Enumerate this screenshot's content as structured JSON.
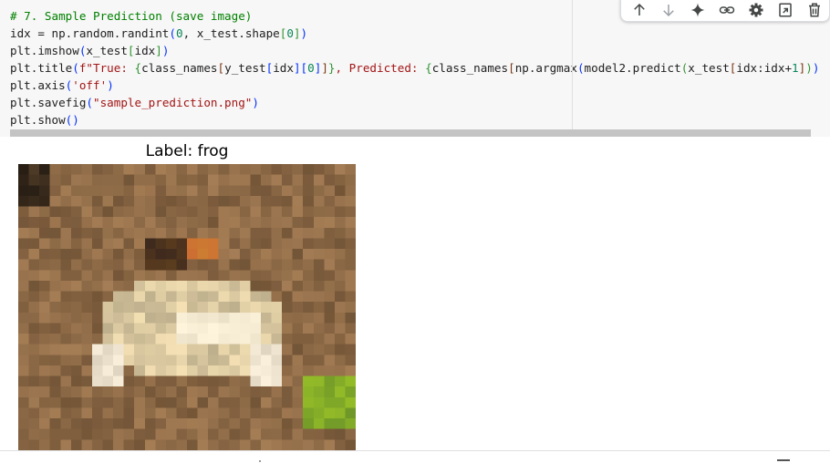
{
  "code_cell": {
    "lines": [
      [
        {
          "t": "# 7. Sample Prediction (save image)",
          "c": "tk-comment"
        }
      ],
      [
        {
          "t": "idx = np.random.randint"
        },
        {
          "t": "(",
          "c": "tk-br1"
        },
        {
          "t": "0",
          "c": "tk-num"
        },
        {
          "t": ", x_test.shape"
        },
        {
          "t": "[",
          "c": "tk-br2"
        },
        {
          "t": "0",
          "c": "tk-num"
        },
        {
          "t": "]",
          "c": "tk-br2"
        },
        {
          "t": ")",
          "c": "tk-br1"
        }
      ],
      [
        {
          "t": "plt.imshow"
        },
        {
          "t": "(",
          "c": "tk-br1"
        },
        {
          "t": "x_test"
        },
        {
          "t": "[",
          "c": "tk-br2"
        },
        {
          "t": "idx"
        },
        {
          "t": "]",
          "c": "tk-br2"
        },
        {
          "t": ")",
          "c": "tk-br1"
        }
      ],
      [
        {
          "t": "plt.title"
        },
        {
          "t": "(",
          "c": "tk-br1"
        },
        {
          "t": "f\"True: ",
          "c": "tk-string"
        },
        {
          "t": "{",
          "c": "tk-br2"
        },
        {
          "t": "class_names"
        },
        {
          "t": "[",
          "c": "tk-br3"
        },
        {
          "t": "y_test"
        },
        {
          "t": "[",
          "c": "tk-br1"
        },
        {
          "t": "idx"
        },
        {
          "t": "]",
          "c": "tk-br1"
        },
        {
          "t": "[",
          "c": "tk-br1"
        },
        {
          "t": "0",
          "c": "tk-num"
        },
        {
          "t": "]",
          "c": "tk-br1"
        },
        {
          "t": "]",
          "c": "tk-br3"
        },
        {
          "t": "}",
          "c": "tk-br2"
        },
        {
          "t": ", Predicted: ",
          "c": "tk-string"
        },
        {
          "t": "{",
          "c": "tk-br2"
        },
        {
          "t": "class_names"
        },
        {
          "t": "[",
          "c": "tk-br3"
        },
        {
          "t": "np.argmax"
        },
        {
          "t": "(",
          "c": "tk-br1"
        },
        {
          "t": "model2.predict"
        },
        {
          "t": "(",
          "c": "tk-br2"
        },
        {
          "t": "x_test"
        },
        {
          "t": "[",
          "c": "tk-br3"
        },
        {
          "t": "idx:idx+"
        },
        {
          "t": "1",
          "c": "tk-num"
        },
        {
          "t": "]",
          "c": "tk-br3"
        },
        {
          "t": ")",
          "c": "tk-br2"
        },
        {
          "t": ")",
          "c": "tk-br1"
        }
      ],
      [
        {
          "t": "plt.axis"
        },
        {
          "t": "(",
          "c": "tk-br1"
        },
        {
          "t": "'off'",
          "c": "tk-string"
        },
        {
          "t": ")",
          "c": "tk-br1"
        }
      ],
      [
        {
          "t": "plt.savefig"
        },
        {
          "t": "(",
          "c": "tk-br1"
        },
        {
          "t": "\"sample_prediction.png\"",
          "c": "tk-string"
        },
        {
          "t": ")",
          "c": "tk-br1"
        }
      ],
      [
        {
          "t": "plt.show"
        },
        {
          "t": "()",
          "c": "tk-br1"
        }
      ]
    ]
  },
  "toolbar": {
    "buttons": [
      {
        "name": "move-cell-up-button",
        "icon": "arrow-up-icon"
      },
      {
        "name": "move-cell-down-button",
        "icon": "arrow-down-icon"
      },
      {
        "name": "gemini-button",
        "icon": "sparkle-icon"
      },
      {
        "name": "link-to-cell-button",
        "icon": "link-icon"
      },
      {
        "name": "cell-settings-button",
        "icon": "gear-icon"
      },
      {
        "name": "open-in-tab-button",
        "icon": "mirror-cell-icon"
      },
      {
        "name": "delete-cell-button",
        "icon": "trash-icon"
      }
    ],
    "icon_color": "#444746"
  },
  "output": {
    "plot_title": "Label: frog",
    "image_description_icon": "frog-image"
  },
  "colors": {
    "comment": "#008000",
    "string": "#a31515",
    "number": "#098658",
    "code_bg": "#f7f7f7"
  }
}
